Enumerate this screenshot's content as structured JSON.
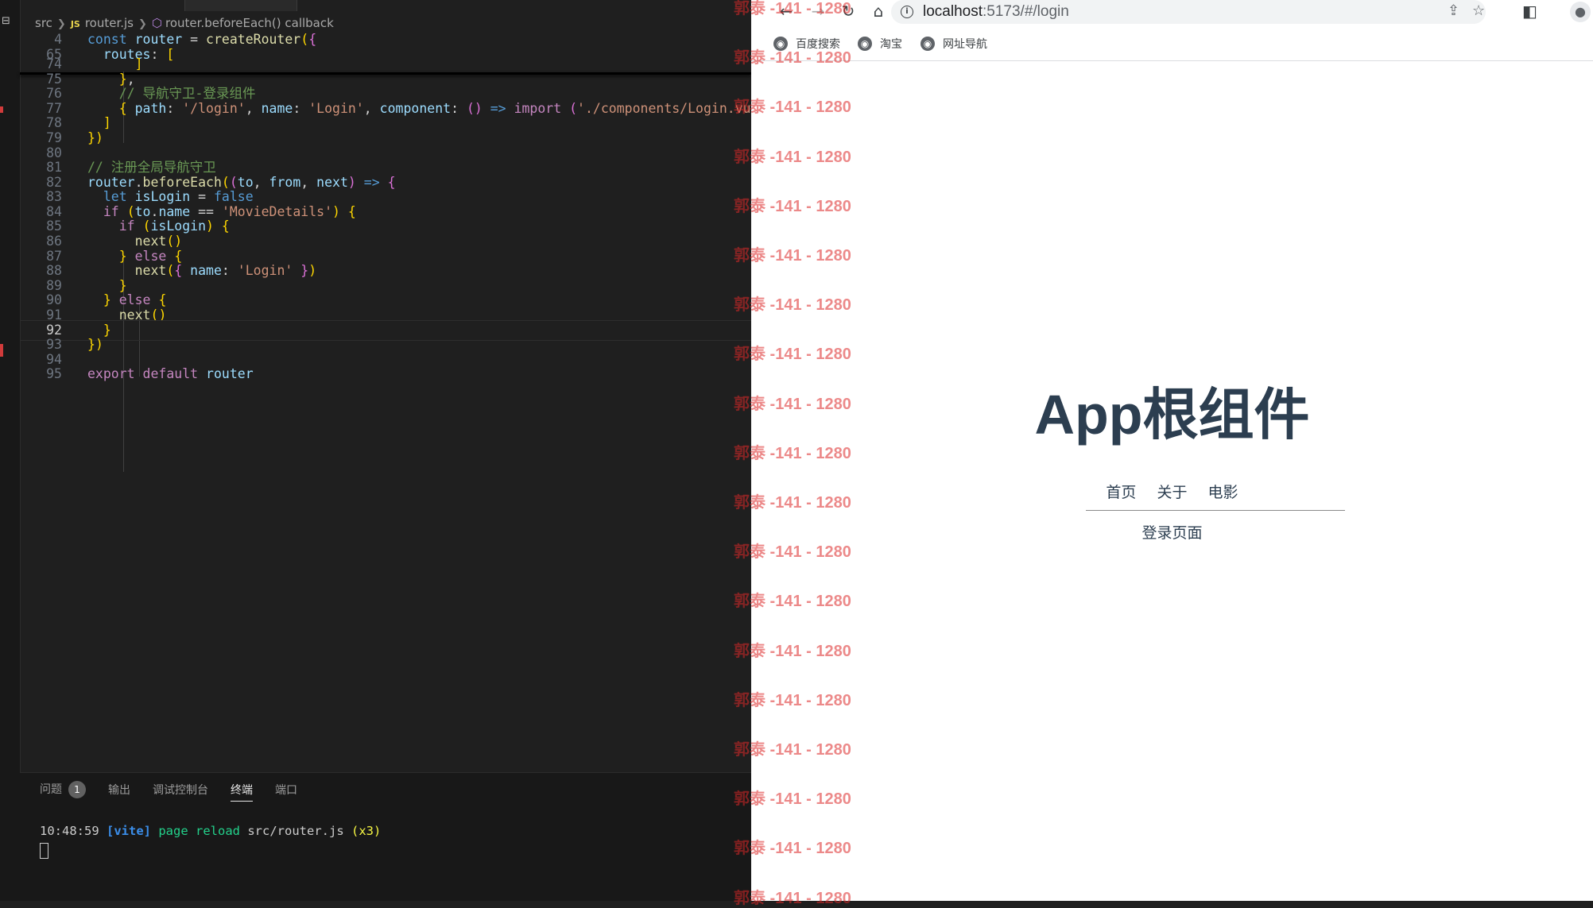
{
  "editor": {
    "breadcrumb": {
      "folder": "src",
      "file_type": "JS",
      "file": "router.js",
      "symbol": "router.beforeEach() callback"
    },
    "lines": [
      {
        "n": "4",
        "code": "const router = createRouter({"
      },
      {
        "n": "65",
        "code": "  routes: ["
      },
      {
        "n": "74",
        "code": "      ]"
      },
      {
        "n": "75",
        "code": "    },"
      },
      {
        "n": "76",
        "code": "    // 导航守卫-登录组件"
      },
      {
        "n": "77",
        "code": "    { path: '/login', name: 'Login', component: () => import ('./components/Login.vue') }"
      },
      {
        "n": "78",
        "code": "  ]"
      },
      {
        "n": "79",
        "code": "})"
      },
      {
        "n": "80",
        "code": ""
      },
      {
        "n": "81",
        "code": "// 注册全局导航守卫"
      },
      {
        "n": "82",
        "code": "router.beforeEach((to, from, next) => {"
      },
      {
        "n": "83",
        "code": "  let isLogin = false"
      },
      {
        "n": "84",
        "code": "  if (to.name == 'MovieDetails') {"
      },
      {
        "n": "85",
        "code": "    if (isLogin) {"
      },
      {
        "n": "86",
        "code": "      next()"
      },
      {
        "n": "87",
        "code": "    } else {"
      },
      {
        "n": "88",
        "code": "      next({ name: 'Login' })"
      },
      {
        "n": "89",
        "code": "    }"
      },
      {
        "n": "90",
        "code": "  } else {"
      },
      {
        "n": "91",
        "code": "    next()"
      },
      {
        "n": "92",
        "code": "  }"
      },
      {
        "n": "93",
        "code": "})"
      },
      {
        "n": "94",
        "code": ""
      },
      {
        "n": "95",
        "code": "export default router"
      }
    ],
    "active_line": "92"
  },
  "panel": {
    "tabs": [
      "问题",
      "输出",
      "调试控制台",
      "终端",
      "端口"
    ],
    "problems_count": "1",
    "active_tab": "终端",
    "terminal": {
      "time": "10:48:59",
      "tag": "[vite]",
      "message": "page reload",
      "file": "src/router.js",
      "count": "(x3)"
    }
  },
  "browser": {
    "url_host": "localhost",
    "url_path": ":5173/#/login",
    "bookmarks": [
      "百度搜索",
      "淘宝",
      "网址导航"
    ],
    "page": {
      "title": "App根组件",
      "nav": [
        "首页",
        "关于",
        "电影"
      ],
      "content": "登录页面"
    }
  },
  "watermark": {
    "text": "郭泰 -141 - 1280"
  },
  "colors": {
    "editor_bg": "#1f1f1f",
    "page_text": "#2c3e50",
    "watermark": "#dc2828"
  }
}
